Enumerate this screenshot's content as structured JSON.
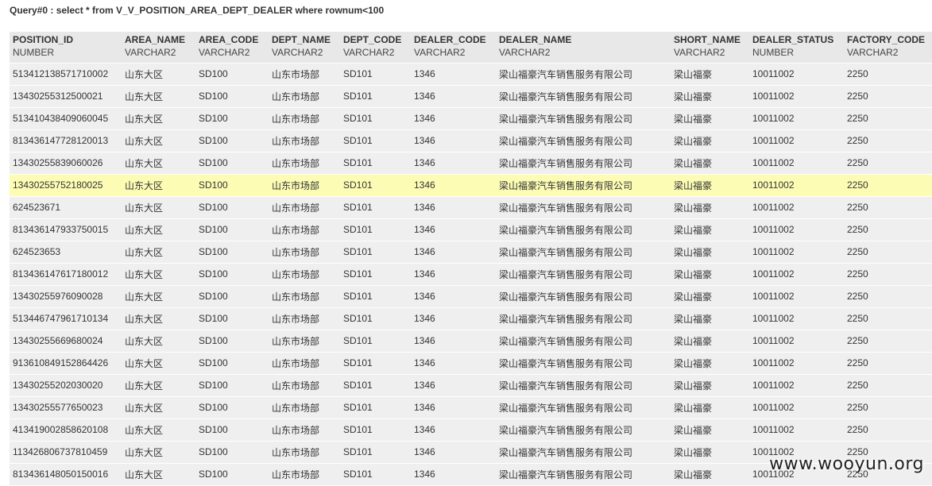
{
  "query_title": "Query#0 : select * from V_V_POSITION_AREA_DEPT_DEALER where rownum<100",
  "columns": [
    {
      "name": "POSITION_ID",
      "type": "NUMBER"
    },
    {
      "name": "AREA_NAME",
      "type": "VARCHAR2"
    },
    {
      "name": "AREA_CODE",
      "type": "VARCHAR2"
    },
    {
      "name": "DEPT_NAME",
      "type": "VARCHAR2"
    },
    {
      "name": "DEPT_CODE",
      "type": "VARCHAR2"
    },
    {
      "name": "DEALER_CODE",
      "type": "VARCHAR2"
    },
    {
      "name": "DEALER_NAME",
      "type": "VARCHAR2"
    },
    {
      "name": "SHORT_NAME",
      "type": "VARCHAR2"
    },
    {
      "name": "DEALER_STATUS",
      "type": "NUMBER"
    },
    {
      "name": "FACTORY_CODE",
      "type": "VARCHAR2"
    }
  ],
  "highlighted_row_index": 5,
  "rows": [
    [
      "513412138571710002",
      "山东大区",
      "SD100",
      "山东市场部",
      "SD101",
      "1346",
      "梁山福豪汽车销售服务有限公司",
      "梁山福豪",
      "10011002",
      "2250"
    ],
    [
      "13430255312500021",
      "山东大区",
      "SD100",
      "山东市场部",
      "SD101",
      "1346",
      "梁山福豪汽车销售服务有限公司",
      "梁山福豪",
      "10011002",
      "2250"
    ],
    [
      "513410438409060045",
      "山东大区",
      "SD100",
      "山东市场部",
      "SD101",
      "1346",
      "梁山福豪汽车销售服务有限公司",
      "梁山福豪",
      "10011002",
      "2250"
    ],
    [
      "813436147728120013",
      "山东大区",
      "SD100",
      "山东市场部",
      "SD101",
      "1346",
      "梁山福豪汽车销售服务有限公司",
      "梁山福豪",
      "10011002",
      "2250"
    ],
    [
      "13430255839060026",
      "山东大区",
      "SD100",
      "山东市场部",
      "SD101",
      "1346",
      "梁山福豪汽车销售服务有限公司",
      "梁山福豪",
      "10011002",
      "2250"
    ],
    [
      "13430255752180025",
      "山东大区",
      "SD100",
      "山东市场部",
      "SD101",
      "1346",
      "梁山福豪汽车销售服务有限公司",
      "梁山福豪",
      "10011002",
      "2250"
    ],
    [
      "624523671",
      "山东大区",
      "SD100",
      "山东市场部",
      "SD101",
      "1346",
      "梁山福豪汽车销售服务有限公司",
      "梁山福豪",
      "10011002",
      "2250"
    ],
    [
      "813436147933750015",
      "山东大区",
      "SD100",
      "山东市场部",
      "SD101",
      "1346",
      "梁山福豪汽车销售服务有限公司",
      "梁山福豪",
      "10011002",
      "2250"
    ],
    [
      "624523653",
      "山东大区",
      "SD100",
      "山东市场部",
      "SD101",
      "1346",
      "梁山福豪汽车销售服务有限公司",
      "梁山福豪",
      "10011002",
      "2250"
    ],
    [
      "813436147617180012",
      "山东大区",
      "SD100",
      "山东市场部",
      "SD101",
      "1346",
      "梁山福豪汽车销售服务有限公司",
      "梁山福豪",
      "10011002",
      "2250"
    ],
    [
      "13430255976090028",
      "山东大区",
      "SD100",
      "山东市场部",
      "SD101",
      "1346",
      "梁山福豪汽车销售服务有限公司",
      "梁山福豪",
      "10011002",
      "2250"
    ],
    [
      "513446747961710134",
      "山东大区",
      "SD100",
      "山东市场部",
      "SD101",
      "1346",
      "梁山福豪汽车销售服务有限公司",
      "梁山福豪",
      "10011002",
      "2250"
    ],
    [
      "13430255669680024",
      "山东大区",
      "SD100",
      "山东市场部",
      "SD101",
      "1346",
      "梁山福豪汽车销售服务有限公司",
      "梁山福豪",
      "10011002",
      "2250"
    ],
    [
      "913610849152864426",
      "山东大区",
      "SD100",
      "山东市场部",
      "SD101",
      "1346",
      "梁山福豪汽车销售服务有限公司",
      "梁山福豪",
      "10011002",
      "2250"
    ],
    [
      "13430255202030020",
      "山东大区",
      "SD100",
      "山东市场部",
      "SD101",
      "1346",
      "梁山福豪汽车销售服务有限公司",
      "梁山福豪",
      "10011002",
      "2250"
    ],
    [
      "13430255577650023",
      "山东大区",
      "SD100",
      "山东市场部",
      "SD101",
      "1346",
      "梁山福豪汽车销售服务有限公司",
      "梁山福豪",
      "10011002",
      "2250"
    ],
    [
      "413419002858620108",
      "山东大区",
      "SD100",
      "山东市场部",
      "SD101",
      "1346",
      "梁山福豪汽车销售服务有限公司",
      "梁山福豪",
      "10011002",
      "2250"
    ],
    [
      "113426806737810459",
      "山东大区",
      "SD100",
      "山东市场部",
      "SD101",
      "1346",
      "梁山福豪汽车销售服务有限公司",
      "梁山福豪",
      "10011002",
      "2250"
    ],
    [
      "813436148050150016",
      "山东大区",
      "SD100",
      "山东市场部",
      "SD101",
      "1346",
      "梁山福豪汽车销售服务有限公司",
      "梁山福豪",
      "10011002",
      "2250"
    ]
  ],
  "watermark": "www.wooyun.org",
  "colors": {
    "header_background": "#e8e8e8",
    "row_background": "#efefef",
    "highlight_background": "#fcfcb4",
    "text": "#333333"
  }
}
